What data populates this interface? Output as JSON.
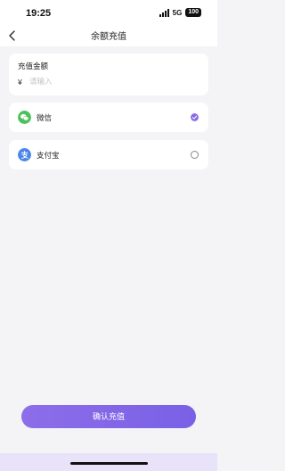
{
  "status_bar": {
    "time": "19:25",
    "network": "5G",
    "battery": "100"
  },
  "header": {
    "title": "余额充值",
    "back_icon": "chevron-left-icon"
  },
  "amount": {
    "label": "充值金额",
    "currency_symbol": "¥",
    "placeholder": "请输入",
    "value": ""
  },
  "payment_methods": [
    {
      "label": "微信",
      "icon": "wechat-icon",
      "icon_color": "#4cc15b",
      "selected": true
    },
    {
      "label": "支付宝",
      "icon": "alipay-icon",
      "icon_color": "#4a86e8",
      "selected": false
    }
  ],
  "confirm": {
    "label": "确认充值"
  },
  "colors": {
    "accent": "#8a68e8",
    "background": "#f4f4f6"
  }
}
